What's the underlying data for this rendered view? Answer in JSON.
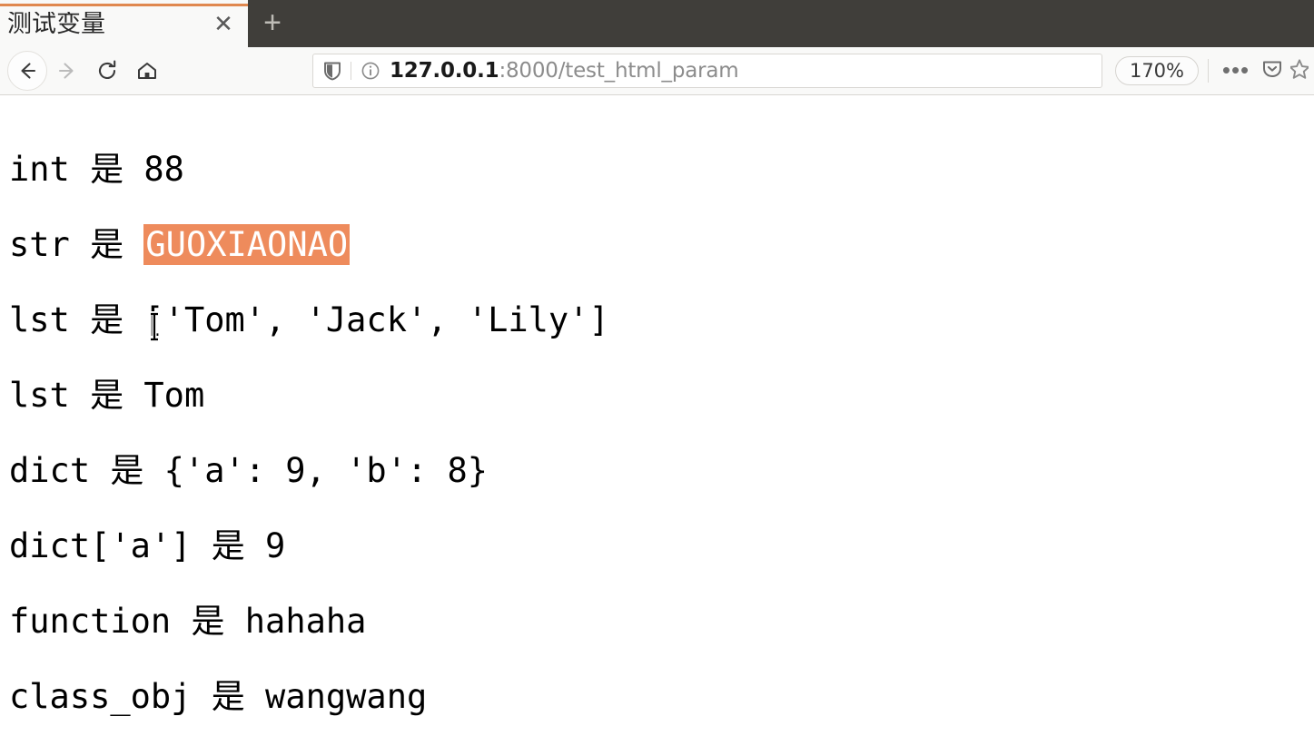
{
  "browser": {
    "tab": {
      "title": "测试变量",
      "close_label": "✕"
    },
    "new_tab_label": "+",
    "toolbar": {
      "back_icon": "back-arrow-icon",
      "forward_icon": "forward-arrow-icon",
      "reload_icon": "reload-icon",
      "home_icon": "home-icon",
      "shield_icon": "tracking-protection-shield-icon",
      "info_icon": "site-information-icon",
      "url_host": "127.0.0.1",
      "url_rest": ":8000/test_html_param",
      "url_full": "127.0.0.1:8000/test_html_param",
      "zoom_level": "170%",
      "overflow_label": "•••",
      "pocket_icon": "pocket-save-icon",
      "bookmark_icon": "bookmark-star-icon"
    },
    "theme": {
      "tabstrip_bg": "#403E3A",
      "active_tab_bg": "#F9F9F8",
      "tab_accent": "#E0884F",
      "toolbar_bg": "#F9F9F8",
      "selection_highlight": "#EE8B5C",
      "selection_text": "#FFFFFF"
    }
  },
  "page": {
    "lines": [
      {
        "prefix": "int 是 ",
        "value": "88",
        "selected": false
      },
      {
        "prefix": "str 是 ",
        "value": "GUOXIAONAO",
        "selected": true
      },
      {
        "prefix": "lst 是 ",
        "value": "['Tom', 'Jack', 'Lily']",
        "selected": false
      },
      {
        "prefix": "lst 是 ",
        "value": "Tom",
        "selected": false
      },
      {
        "prefix": "dict 是 ",
        "value": "{'a': 9, 'b': 8}",
        "selected": false
      },
      {
        "prefix": "dict['a'] 是 ",
        "value": "9",
        "selected": false
      },
      {
        "prefix": "function 是 ",
        "value": "hahaha",
        "selected": false
      },
      {
        "prefix": "class_obj 是 ",
        "value": "wangwang",
        "selected": false
      }
    ],
    "cursor_icon": "text-ibeam-cursor"
  }
}
